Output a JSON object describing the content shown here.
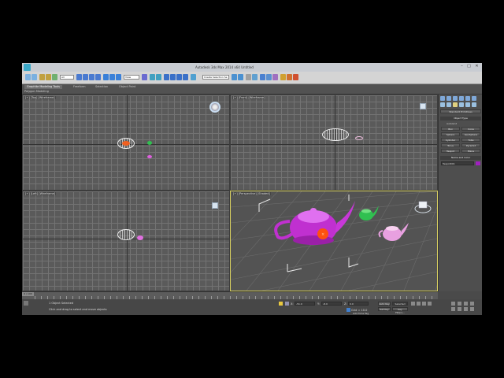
{
  "window": {
    "title": "Autodesk 3ds Max 2014 x64   Untitled",
    "minimize": "–",
    "maximize": "□",
    "close": "✕"
  },
  "toolbar": {
    "selection_filter": "All",
    "view_dropdown": "View",
    "named_selection": "Create Selection Se"
  },
  "ribbon": {
    "tabs": [
      "Graphite Modeling Tools",
      "Freeform",
      "Selection",
      "Object Paint"
    ],
    "sub_label": "Polygon Modeling"
  },
  "viewports": {
    "top": "[+] [Top] [Wireframe]",
    "front": "[+] [Front] [Wireframe]",
    "left": "[+] [Left] [Wireframe]",
    "perspective": "[+] [Perspective] [Shaded]"
  },
  "command_panel": {
    "dropdown": "Standard Primitives",
    "object_type_header": "Object Type",
    "autogrid": "AutoGrid",
    "buttons": [
      "Box",
      "Cone",
      "Sphere",
      "GeoSphere",
      "Cylinder",
      "Tube",
      "Torus",
      "Pyramid",
      "Teapot",
      "Plane"
    ],
    "name_color_header": "Name and Color",
    "name_value": "Teapot001",
    "swatch_color": "#a020c0"
  },
  "timeline": {
    "slider": "0 / 100"
  },
  "status": {
    "selected": "1 Object Selected",
    "prompt": "Click and drag to select and move objects",
    "x_label": "X:",
    "y_label": "Y:",
    "z_label": "Z:",
    "x": "-51.0",
    "y": "-8.0",
    "z": "0.0",
    "grid": "Grid = 10.0",
    "auto_key": "Auto Key",
    "selected_drop": "Selected",
    "set_key": "Set Key",
    "key_filters": "Key Filters...",
    "add_time_tag": "Add Time Tag"
  },
  "colors": {
    "teapot_magenta": "#d040e0",
    "teapot_pink": "#e890e0",
    "teapot_green": "#30c050",
    "gizmo_orange": "#ff5010",
    "active_border": "#d8d060"
  }
}
